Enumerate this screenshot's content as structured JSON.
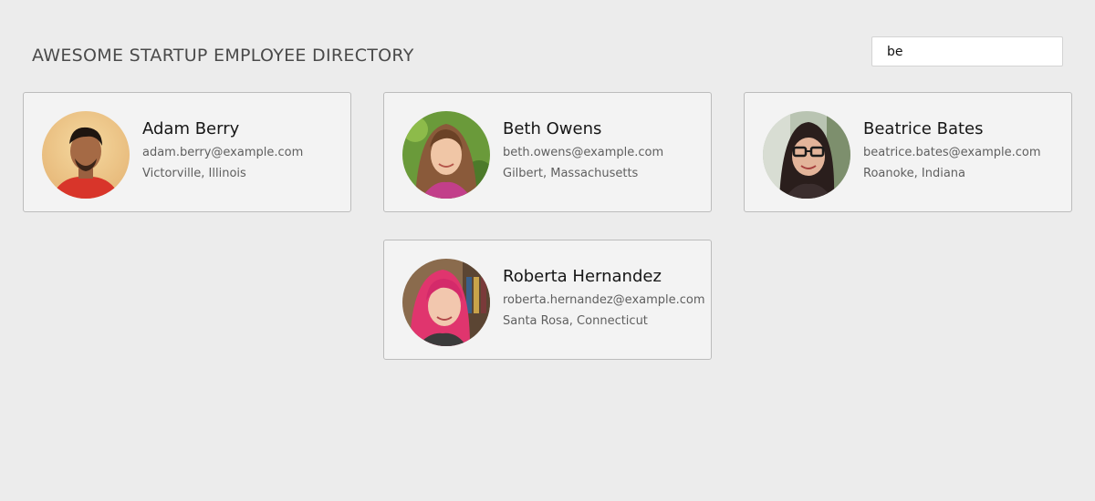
{
  "header": {
    "title": "AWESOME STARTUP EMPLOYEE DIRECTORY"
  },
  "search": {
    "value": "be"
  },
  "employees": [
    {
      "name": "Adam Berry",
      "email": "adam.berry@example.com",
      "location": "Victorville, Illinois"
    },
    {
      "name": "Beth Owens",
      "email": "beth.owens@example.com",
      "location": "Gilbert, Massachusetts"
    },
    {
      "name": "Beatrice Bates",
      "email": "beatrice.bates@example.com",
      "location": "Roanoke, Indiana"
    },
    {
      "name": "Roberta Hernandez",
      "email": "roberta.hernandez@example.com",
      "location": "Santa Rosa, Connecticut"
    }
  ],
  "colors": {
    "background": "#ececec",
    "card_background": "#f3f3f3",
    "card_border": "#bcbcbc",
    "title_text": "#4a4a4a",
    "secondary_text": "#5f5f5f"
  }
}
